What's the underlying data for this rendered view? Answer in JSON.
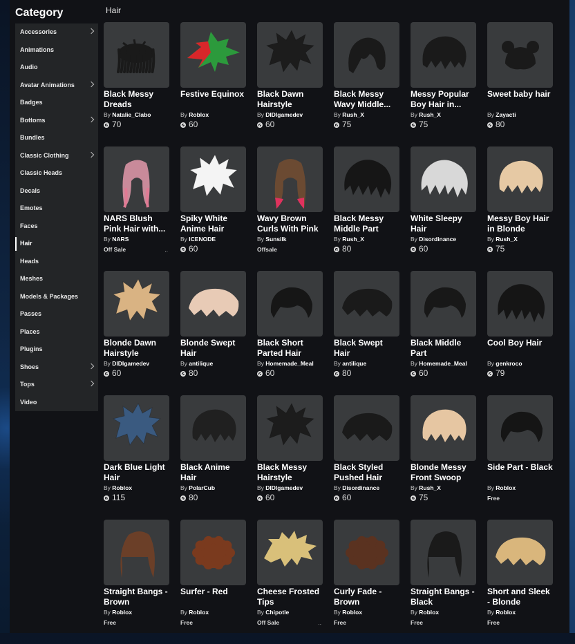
{
  "sidebar": {
    "title": "Category",
    "items": [
      {
        "label": "Accessories",
        "chevron": true
      },
      {
        "label": "Animations",
        "chevron": false
      },
      {
        "label": "Audio",
        "chevron": false
      },
      {
        "label": "Avatar Animations",
        "chevron": true
      },
      {
        "label": "Badges",
        "chevron": false
      },
      {
        "label": "Bottoms",
        "chevron": true
      },
      {
        "label": "Bundles",
        "chevron": false
      },
      {
        "label": "Classic Clothing",
        "chevron": true
      },
      {
        "label": "Classic Heads",
        "chevron": false
      },
      {
        "label": "Decals",
        "chevron": false
      },
      {
        "label": "Emotes",
        "chevron": false
      },
      {
        "label": "Faces",
        "chevron": false
      },
      {
        "label": "Hair",
        "chevron": false,
        "selected": true
      },
      {
        "label": "Heads",
        "chevron": false
      },
      {
        "label": "Meshes",
        "chevron": false
      },
      {
        "label": "Models & Packages",
        "chevron": false
      },
      {
        "label": "Passes",
        "chevron": false
      },
      {
        "label": "Places",
        "chevron": false
      },
      {
        "label": "Plugins",
        "chevron": false
      },
      {
        "label": "Shoes",
        "chevron": true
      },
      {
        "label": "Tops",
        "chevron": true
      },
      {
        "label": "Video",
        "chevron": false
      }
    ]
  },
  "breadcrumb": "Hair",
  "items": [
    {
      "name": "Black Messy Dreads",
      "creator": "Natalie_Clabo",
      "price": "70",
      "hair": "dreads",
      "color": "#1a1a1a"
    },
    {
      "name": "Festive Equinox",
      "creator": "Roblox",
      "price": "60",
      "hair": "festive",
      "color": "#2a9a3a"
    },
    {
      "name": "Black Dawn Hairstyle",
      "creator": "DIDIgamedev",
      "price": "60",
      "hair": "spiky",
      "color": "#1c1c1c"
    },
    {
      "name": "Black Messy Wavy Middle...",
      "creator": "Rush_X",
      "price": "75",
      "hair": "wavy",
      "color": "#1a1a1a"
    },
    {
      "name": "Messy Popular Boy Hair in...",
      "creator": "Rush_X",
      "price": "75",
      "hair": "bowl",
      "color": "#1a1a1a"
    },
    {
      "name": "Sweet baby hair",
      "creator": "Zayacti",
      "price": "80",
      "hair": "buns",
      "color": "#1a1a1a"
    },
    {
      "name": "NARS Blush Pink Hair with...",
      "creator": "NARS",
      "status": "Off Sale",
      "dots": "..",
      "hair": "long",
      "color": "#c98a9a"
    },
    {
      "name": "Spiky White Anime Hair",
      "creator": "ICENODE",
      "price": "60",
      "hair": "spikywhite",
      "color": "#f2f2f2"
    },
    {
      "name": "Wavy Brown Curls With Pink",
      "creator": "Sunsilk",
      "status": "Offsale",
      "hair": "longombre",
      "color": "#6b4a32"
    },
    {
      "name": "Black Messy Middle Part",
      "creator": "Rush_X",
      "price": "80",
      "hair": "messy",
      "color": "#161616"
    },
    {
      "name": "White Sleepy Hair",
      "creator": "Disordinance",
      "price": "60",
      "hair": "messy",
      "color": "#d8d8d8"
    },
    {
      "name": "Messy Boy Hair in Blonde",
      "creator": "Rush_X",
      "price": "75",
      "hair": "bowl",
      "color": "#e6c9a4"
    },
    {
      "name": "Blonde Dawn Hairstyle",
      "creator": "DIDIgamedev",
      "price": "60",
      "hair": "spiky",
      "color": "#d9b383"
    },
    {
      "name": "Blonde Swept Hair",
      "creator": "antilique",
      "price": "80",
      "hair": "swept",
      "color": "#e8cbb6"
    },
    {
      "name": "Black Short Parted Hair",
      "creator": "Homemade_Meal",
      "price": "60",
      "hair": "short",
      "color": "#161616"
    },
    {
      "name": "Black Swept Hair",
      "creator": "antilique",
      "price": "80",
      "hair": "swept",
      "color": "#1a1a1a"
    },
    {
      "name": "Black Middle Part",
      "creator": "Homemade_Meal",
      "price": "60",
      "hair": "short",
      "color": "#181818"
    },
    {
      "name": "Cool Boy Hair",
      "creator": "genkroco",
      "price": "79",
      "hair": "messy",
      "color": "#151515"
    },
    {
      "name": "Dark Blue Light Hair",
      "creator": "Roblox",
      "price": "115",
      "hair": "spiky",
      "color": "#3a5a80"
    },
    {
      "name": "Black Anime Hair",
      "creator": "PolarCub",
      "price": "80",
      "hair": "bowl",
      "color": "#202020"
    },
    {
      "name": "Black Messy Hairstyle",
      "creator": "DIDIgamedev",
      "price": "60",
      "hair": "spiky",
      "color": "#1c1c1c"
    },
    {
      "name": "Black Styled Pushed Hair",
      "creator": "Disordinance",
      "price": "60",
      "hair": "swept",
      "color": "#1a1a1a"
    },
    {
      "name": "Blonde Messy Front Swoop",
      "creator": "Rush_X",
      "price": "75",
      "hair": "bowl",
      "color": "#e6c6a2"
    },
    {
      "name": "Side Part - Black",
      "creator": "Roblox",
      "status": "Free",
      "hair": "short",
      "color": "#151515"
    },
    {
      "name": "Straight Bangs - Brown",
      "creator": "Roblox",
      "status": "Free",
      "hair": "bangs",
      "color": "#6b3f28"
    },
    {
      "name": "Surfer - Red",
      "creator": "Roblox",
      "status": "Free",
      "hair": "curly",
      "color": "#7a3a1e"
    },
    {
      "name": "Cheese Frosted Tips",
      "creator": "Chipotle",
      "status": "Off Sale",
      "dots": "..",
      "hair": "frosted",
      "color": "#d9c07a"
    },
    {
      "name": "Curly Fade - Brown",
      "creator": "Roblox",
      "status": "Free",
      "hair": "curly",
      "color": "#5a3220"
    },
    {
      "name": "Straight Bangs - Black",
      "creator": "Roblox",
      "status": "Free",
      "hair": "bangs",
      "color": "#1a1a1a"
    },
    {
      "name": "Short and Sleek - Blonde",
      "creator": "Roblox",
      "status": "Free",
      "hair": "swept",
      "color": "#d9b67c"
    }
  ]
}
